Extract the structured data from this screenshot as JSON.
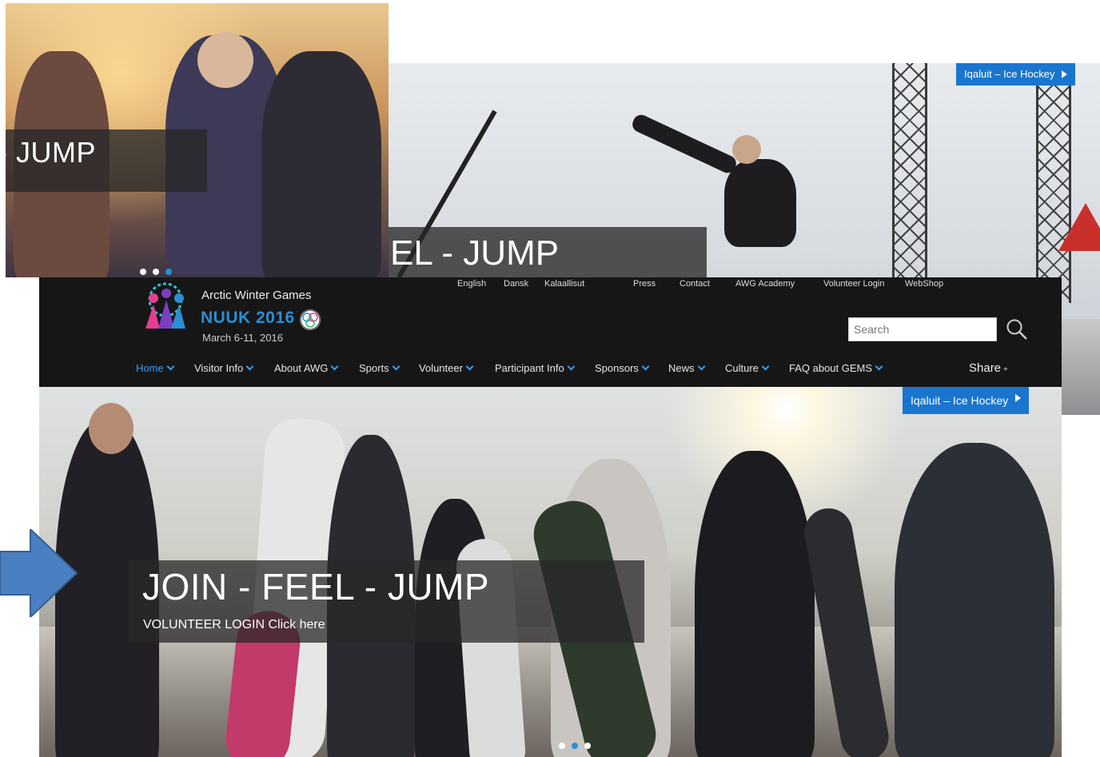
{
  "background_slides": [
    {
      "caption": "- JUMP"
    },
    {
      "caption": "EL - JUMP",
      "tag": "Iqaluit – Ice Hockey"
    }
  ],
  "header": {
    "logo": {
      "line1": "Arctic Winter Games",
      "line2": "NUUK 2016",
      "dates": "March 6-11, 2016"
    },
    "languages": [
      "English",
      "Dansk",
      "Kalaallisut"
    ],
    "top_links": [
      "Press",
      "Contact",
      "AWG Academy",
      "Volunteer Login",
      "WebShop"
    ],
    "search": {
      "placeholder": "Search"
    },
    "nav": [
      "Home",
      "Visitor Info",
      "About AWG",
      "Sports",
      "Volunteer",
      "Participant Info",
      "Sponsors",
      "News",
      "Culture",
      "FAQ about GEMS"
    ],
    "active_nav": "Home",
    "share": "Share"
  },
  "hero": {
    "tag": "Iqaluit – Ice Hockey",
    "headline": "JOIN - FEEL - JUMP",
    "sub": "VOLUNTEER LOGIN Click here",
    "slides_total": 3,
    "slides_active": 2
  },
  "colors": {
    "accent": "#2a8fd4",
    "tag": "#1a75cf",
    "header_bg": "#161616",
    "arrow": "#4a7fc1"
  }
}
